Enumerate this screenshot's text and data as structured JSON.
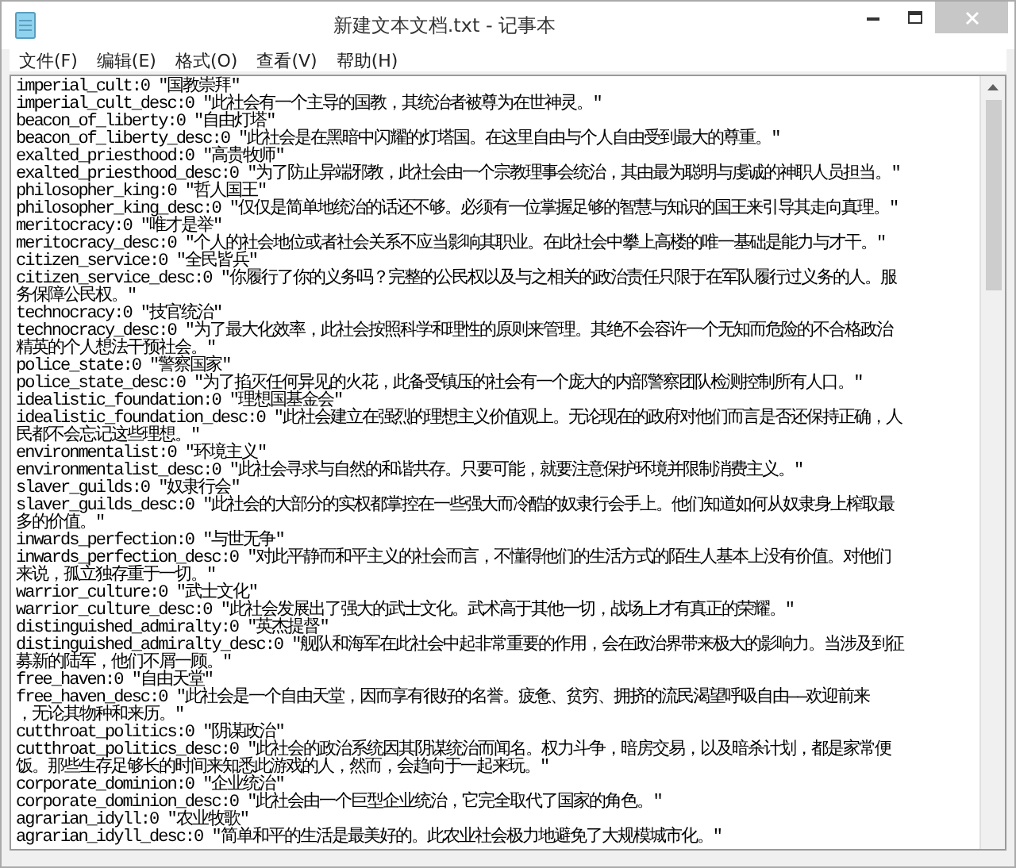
{
  "window": {
    "title": "新建文本文档.txt - 记事本"
  },
  "menu": [
    "文件(F)",
    "编辑(E)",
    "格式(O)",
    "查看(V)",
    "帮助(H)"
  ],
  "lines": [
    "imperial_cult:0 \"国教崇拜\"",
    "imperial_cult_desc:0 \"此社会有一个主导的国教，其统治者被尊为在世神灵。\"",
    "beacon_of_liberty:0 \"自由灯塔\"",
    "beacon_of_liberty_desc:0 \"此社会是在黑暗中闪耀的灯塔国。在这里自由与个人自由受到最大的尊重。\"",
    "exalted_priesthood:0 \"高贵牧师\"",
    "exalted_priesthood_desc:0 \"为了防止异端邪教，此社会由一个宗教理事会统治，其由最为聪明与虔诚的神职人员担当。\"",
    "philosopher_king:0 \"哲人国王\"",
    "philosopher_king_desc:0 \"仅仅是简单地统治的话还不够。必须有一位掌握足够的智慧与知识的国王来引导其走向真理。\"",
    "meritocracy:0 \"唯才是举\"",
    "meritocracy_desc:0 \"个人的社会地位或者社会关系不应当影响其职业。在此社会中攀上高楼的唯一基础是能力与才干。\"",
    "citizen_service:0 \"全民皆兵\"",
    "citizen_service_desc:0 \"你履行了你的义务吗？完整的公民权以及与之相关的政治责任只限于在军队履行过义务的人。服",
    "务保障公民权。\"",
    "technocracy:0 \"技官统治\"",
    "technocracy_desc:0 \"为了最大化效率，此社会按照科学和理性的原则来管理。其绝不会容许一个无知而危险的不合格政治",
    "精英的个人想法干预社会。\"",
    "police_state:0 \"警察国家\"",
    "police_state_desc:0 \"为了掐灭任何异见的火花，此备受镇压的社会有一个庞大的内部警察团队检测控制所有人口。\"",
    "idealistic_foundation:0 \"理想国基金会\"",
    "idealistic_foundation_desc:0 \"此社会建立在强烈的理想主义价值观上。无论现在的政府对他们而言是否还保持正确，人",
    "民都不会忘记这些理想。\"",
    "environmentalist:0 \"环境主义\"",
    "environmentalist_desc:0 \"此社会寻求与自然的和谐共存。只要可能，就要注意保护环境并限制消费主义。\"",
    "slaver_guilds:0 \"奴隶行会\"",
    "slaver_guilds_desc:0 \"此社会的大部分的实权都掌控在一些强大而冷酷的奴隶行会手上。他们知道如何从奴隶身上榨取最",
    "多的价值。\"",
    "inwards_perfection:0 \"与世无争\"",
    "inwards_perfection_desc:0 \"对此平静而和平主义的社会而言，不懂得他们的生活方式的陌生人基本上没有价值。对他们",
    "来说，孤立独存重于一切。\"",
    "warrior_culture:0 \"武士文化\"",
    "warrior_culture_desc:0 \"此社会发展出了强大的武士文化。武术高于其他一切，战场上才有真正的荣耀。\"",
    "distinguished_admiralty:0 \"英杰提督\"",
    "distinguished_admiralty_desc:0 \"舰队和海军在此社会中起非常重要的作用，会在政治界带来极大的影响力。当涉及到征",
    "募新的陆军，他们不屑一顾。\"",
    "free_haven:0 \"自由天堂\"",
    "free_haven_desc:0 \"此社会是一个自由天堂，因而享有很好的名誉。疲惫、贫穷、拥挤的流民渴望呼吸自由——欢迎前来",
    "，无论其物种和来历。\"",
    "cutthroat_politics:0 \"阴谋政治\"",
    "cutthroat_politics_desc:0 \"此社会的政治系统因其阴谋统治而闻名。权力斗争，暗房交易，以及暗杀计划，都是家常便",
    "饭。那些生存足够长的时间来知悉此游戏的人，然而，会趋向于一起来玩。\"",
    "corporate_dominion:0 \"企业统治\"",
    "corporate_dominion_desc:0 \"此社会由一个巨型企业统治，它完全取代了国家的角色。\"",
    "agrarian_idyll:0 \"农业牧歌\"",
    "agrarian_idyll_desc:0 \"简单和平的生活是最美好的。此农业社会极力地避免了大规模城市化。\""
  ]
}
